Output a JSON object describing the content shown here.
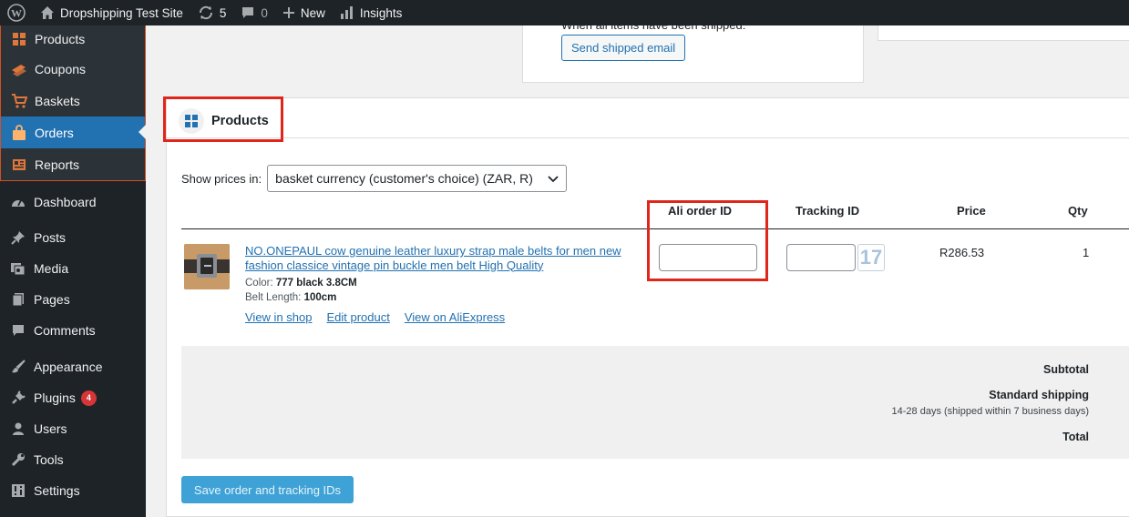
{
  "adminbar": {
    "site_name": "Dropshipping Test Site",
    "updates_count": "5",
    "comments_count": "0",
    "new_label": "New",
    "insights_label": "Insights"
  },
  "sidebar": {
    "woo_items": [
      {
        "label": "Products",
        "icon": "grid-icon"
      },
      {
        "label": "Coupons",
        "icon": "coupon-icon"
      },
      {
        "label": "Baskets",
        "icon": "cart-icon"
      },
      {
        "label": "Orders",
        "icon": "bag-icon"
      },
      {
        "label": "Reports",
        "icon": "report-icon"
      }
    ],
    "main_items": [
      {
        "label": "Dashboard"
      },
      {
        "label": "Posts"
      },
      {
        "label": "Media"
      },
      {
        "label": "Pages"
      },
      {
        "label": "Comments"
      },
      {
        "label": "Appearance"
      },
      {
        "label": "Plugins",
        "badge": "4"
      },
      {
        "label": "Users"
      },
      {
        "label": "Tools"
      },
      {
        "label": "Settings"
      }
    ]
  },
  "top_card": {
    "partial_text": "When all items have been shipped:",
    "send_email_label": "Send shipped email"
  },
  "products_panel": {
    "title": "Products",
    "show_prices_label": "Show prices in:",
    "currency_selected": "basket currency (customer's choice) (ZAR, R)",
    "columns": {
      "ali_order_id": "Ali order ID",
      "tracking_id": "Tracking ID",
      "price": "Price",
      "qty": "Qty"
    },
    "item": {
      "name": "NO.ONEPAUL cow genuine leather luxury strap male belts for men new fashion classice vintage pin buckle men belt High Quality",
      "color_label": "Color:",
      "color_value": "777 black 3.8CM",
      "length_label": "Belt Length:",
      "length_value": "100cm",
      "link_view_shop": "View in shop",
      "link_edit": "Edit product",
      "link_aliexpress": "View on AliExpress",
      "ali_order_id": "",
      "tracking_id": "",
      "tracker_badge": "17",
      "price": "R286.53",
      "qty": "1"
    },
    "totals": {
      "subtotal_label": "Subtotal",
      "shipping_label": "Standard shipping",
      "shipping_note": "14-28 days (shipped within 7 business days)",
      "total_label": "Total"
    },
    "save_button_label": "Save order and tracking IDs"
  },
  "colors": {
    "adminbar_bg": "#1d2327",
    "active_menu": "#2271b1",
    "highlight_box": "#e0261b",
    "woo_icon": "#e0763a",
    "link": "#2271b1",
    "save_button": "#3ea2d6"
  }
}
